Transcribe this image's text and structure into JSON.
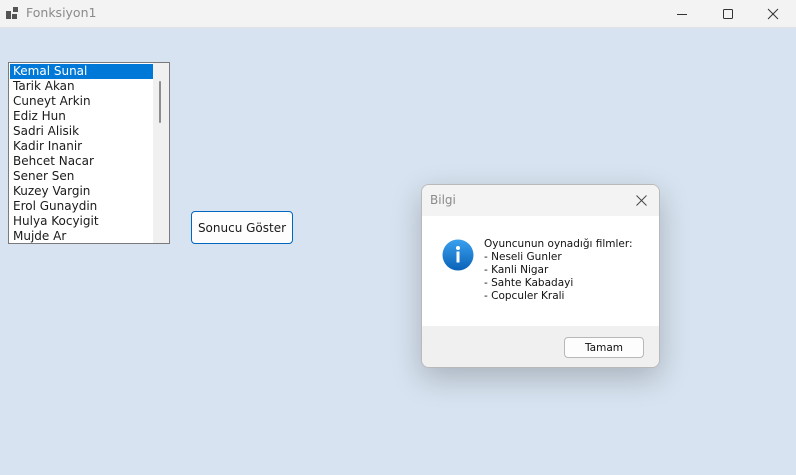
{
  "window": {
    "title": "Fonksiyon1",
    "icon": "app-window-icon"
  },
  "listbox": {
    "items": [
      "Kemal Sunal",
      "Tarik Akan",
      "Cuneyt Arkin",
      "Ediz Hun",
      "Sadri Alisik",
      "Kadir Inanir",
      "Behcet Nacar",
      "Sener Sen",
      "Kuzey Vargin",
      "Erol Gunaydin",
      "Hulya Kocyigit",
      "Mujde Ar"
    ],
    "selected": "Kemal Sunal"
  },
  "button": {
    "label": "Sonucu Göster"
  },
  "dialog": {
    "title": "Bilgi",
    "icon": "info-icon",
    "lines": [
      "Oyuncunun oynadığı filmler:",
      "- Neseli Gunler",
      "- Kanli Nigar",
      "- Sahte Kabadayi",
      "- Copculer Krali"
    ],
    "ok_label": "Tamam"
  },
  "colors": {
    "background": "#d7e3f0",
    "selection": "#0078d7",
    "accent_border": "#0067c0",
    "info_icon": "#1a7fd4"
  }
}
